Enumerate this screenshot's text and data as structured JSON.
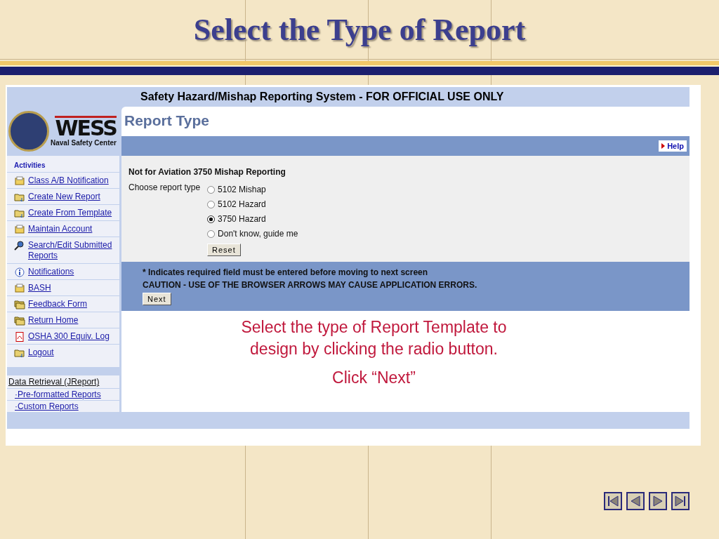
{
  "slide_title": "Select the Type of Report",
  "app": {
    "header": "Safety Hazard/Mishap Reporting System - FOR OFFICIAL USE ONLY",
    "logo": {
      "name": "WESS",
      "subtitle": "Naval Safety Center"
    },
    "sidebar": {
      "heading": "Activities",
      "items": [
        {
          "label": "Class A/B Notification",
          "kind": "tray"
        },
        {
          "label": "Create New Report",
          "kind": "folder"
        },
        {
          "label": "Create From Template",
          "kind": "folder"
        },
        {
          "label": "Maintain Account",
          "kind": "tray"
        },
        {
          "label": "Search/Edit Submitted Reports",
          "kind": "search"
        },
        {
          "label": "Notifications",
          "kind": "info"
        },
        {
          "label": "BASH",
          "kind": "tray"
        },
        {
          "label": "Feedback Form",
          "kind": "folders"
        },
        {
          "label": "Return Home",
          "kind": "folders"
        },
        {
          "label": "OSHA 300 Equiv. Log",
          "kind": "pdf"
        },
        {
          "label": "Logout",
          "kind": "folder"
        }
      ],
      "section": "Data Retrieval (JReport)",
      "links": [
        "·Pre-formatted Reports",
        "·Custom Reports"
      ]
    },
    "page_title": "Report Type",
    "help": "Help",
    "notice": "Not for Aviation 3750 Mishap Reporting",
    "prompt": "Choose report type",
    "options": [
      {
        "label": "5102 Mishap",
        "selected": false
      },
      {
        "label": "5102 Hazard",
        "selected": false
      },
      {
        "label": "3750 Hazard",
        "selected": true
      },
      {
        "label": "Don't know, guide me",
        "selected": false
      }
    ],
    "reset": "Reset",
    "footer_lines": [
      "* Indicates required field must be entered before moving to next screen",
      "CAUTION - USE OF THE BROWSER ARROWS MAY CAUSE APPLICATION ERRORS."
    ],
    "next": "Next"
  },
  "caption": "Select the type of Report Template to design by clicking the radio button.",
  "instruction": "Click “Next”"
}
